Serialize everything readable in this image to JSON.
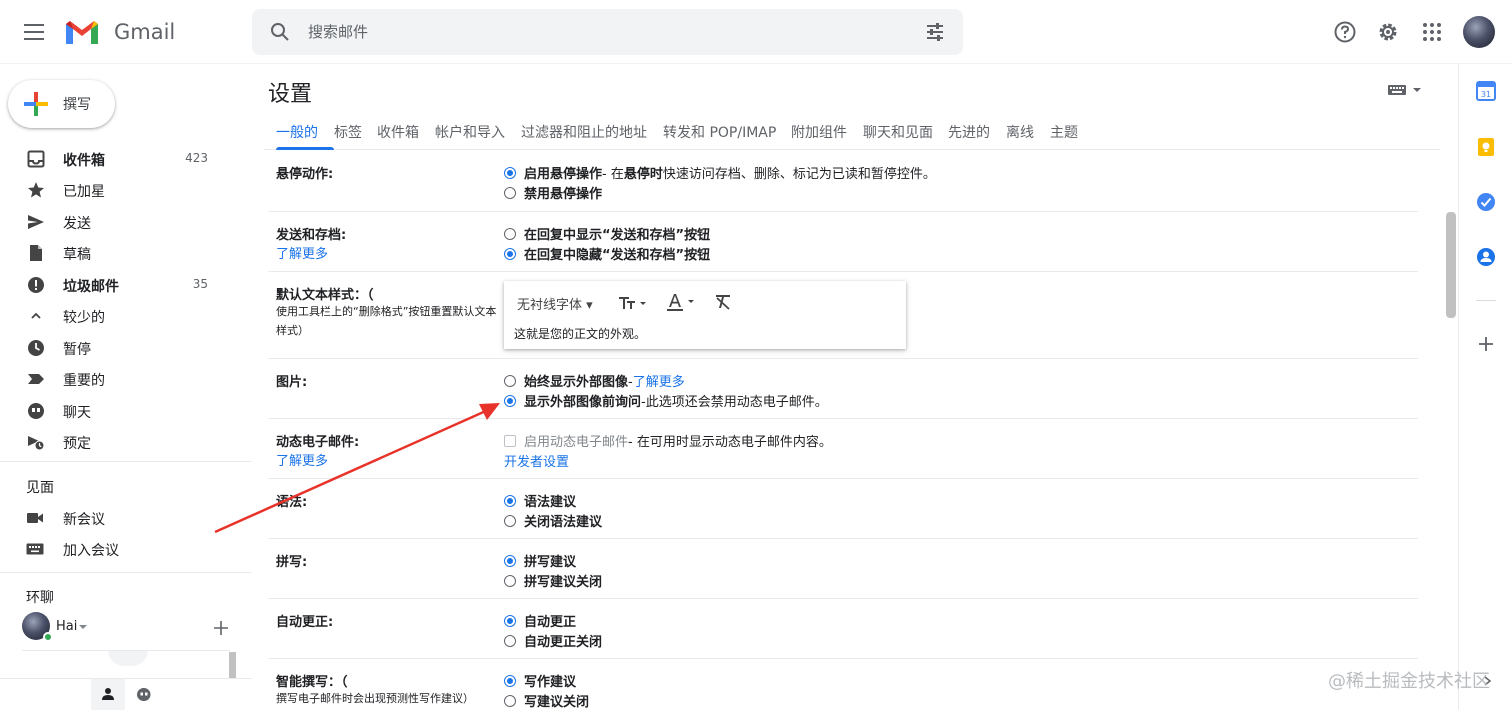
{
  "header": {
    "app_name": "Gmail",
    "search_placeholder": "搜索邮件"
  },
  "sidebar": {
    "compose_label": "撰写",
    "items": [
      {
        "label": "收件箱",
        "count": "423",
        "icon": "inbox-icon",
        "bold": true
      },
      {
        "label": "已加星",
        "count": "",
        "icon": "star-icon",
        "bold": false
      },
      {
        "label": "发送",
        "count": "",
        "icon": "send-icon",
        "bold": false
      },
      {
        "label": "草稿",
        "count": "",
        "icon": "draft-icon",
        "bold": false
      },
      {
        "label": "垃圾邮件",
        "count": "35",
        "icon": "spam-icon",
        "bold": true
      },
      {
        "label": "较少的",
        "count": "",
        "icon": "chevron-up-icon",
        "bold": false
      },
      {
        "label": "暂停",
        "count": "",
        "icon": "clock-icon",
        "bold": false
      },
      {
        "label": "重要的",
        "count": "",
        "icon": "important-icon",
        "bold": false
      },
      {
        "label": "聊天",
        "count": "",
        "icon": "chat-icon",
        "bold": false
      },
      {
        "label": "预定",
        "count": "",
        "icon": "scheduled-icon",
        "bold": false
      }
    ],
    "meet": {
      "title": "见面",
      "new_meeting": "新会议",
      "join_meeting": "加入会议"
    },
    "hangouts": {
      "title": "环聊",
      "user": "Hai"
    }
  },
  "settings": {
    "title": "设置",
    "tabs": [
      "一般的",
      "标签",
      "收件箱",
      "帐户和导入",
      "过滤器和阻止的地址",
      "转发和 POP/IMAP",
      "附加组件",
      "聊天和见面",
      "先进的",
      "离线",
      "主题"
    ],
    "hover": {
      "label": "悬停动作:",
      "opt1_bold": "启用悬停操作",
      "opt1_rest_a": "- 在",
      "opt1_bold2": "悬停时",
      "opt1_rest_b": "快速访问存档、删除、标记为已读和暂停控件。",
      "opt2": "禁用悬停操作"
    },
    "send_archive": {
      "label": "发送和存档:",
      "learn_more": "了解更多",
      "opt1": "在回复中显示“发送和存档”按钮",
      "opt2": "在回复中隐藏“发送和存档”按钮"
    },
    "default_text": {
      "label": "默认文本样式：（",
      "sub": "使用工具栏上的“删除格式”按钮重置默认文本样式）",
      "font_name": "无衬线字体",
      "sample": "这就是您的正文的外观。"
    },
    "images": {
      "label": "图片:",
      "opt1": "始终显示外部图像",
      "opt1_link": "了解更多",
      "opt2": "显示外部图像前询问",
      "opt2_rest": "-此选项还会禁用动态电子邮件。"
    },
    "dynamic": {
      "label": "动态电子邮件:",
      "learn_more": "了解更多",
      "opt1": "启用动态电子邮件",
      "opt1_rest": "- 在可用时显示动态电子邮件内容。",
      "dev_link": "开发者设置"
    },
    "grammar": {
      "label": "语法:",
      "opt1": "语法建议",
      "opt2": "关闭语法建议"
    },
    "spelling": {
      "label": "拼写:",
      "opt1": "拼写建议",
      "opt2": "拼写建议关闭"
    },
    "autocorrect": {
      "label": "自动更正:",
      "opt1": "自动更正",
      "opt2": "自动更正关闭"
    },
    "smart_compose": {
      "label": "智能撰写：（",
      "sub": "撰写电子邮件时会出现预测性写作建议）",
      "opt1": "写作建议",
      "opt2": "写建议关闭"
    }
  },
  "watermark": "@稀土掘金技术社区",
  "colors": {
    "accent": "#1a73e8",
    "annotation_arrow": "#e8332a"
  }
}
